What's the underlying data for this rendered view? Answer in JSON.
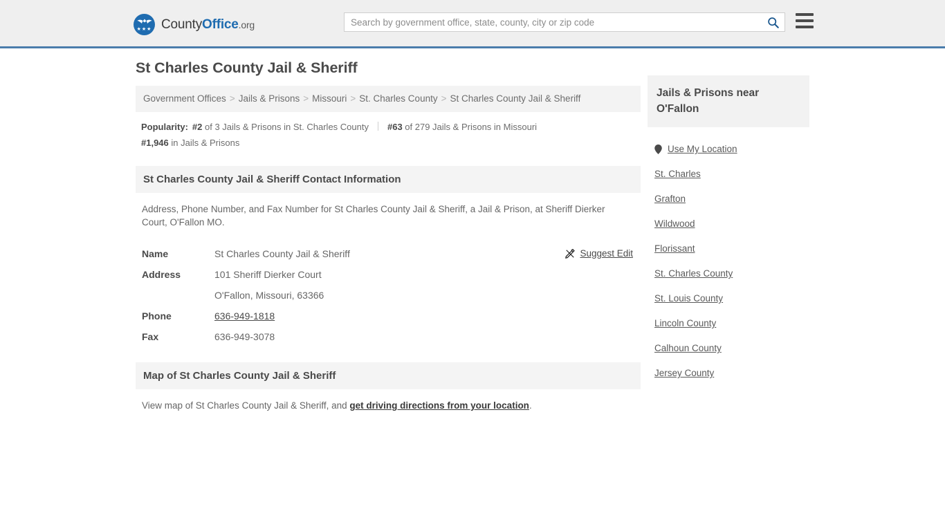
{
  "header": {
    "brand": {
      "name_part1": "County",
      "name_part2": "Office",
      "name_part3": ".org",
      "logo_icon": "eagle-shield-logo",
      "stars": "★★★"
    },
    "search": {
      "placeholder": "Search by government office, state, county, city or zip code",
      "value": "",
      "search_icon": "search-icon"
    },
    "menu_icon": "hamburger-menu-icon",
    "accent_color": "#4a7cab"
  },
  "page": {
    "title": "St Charles County Jail & Sheriff"
  },
  "breadcrumb": {
    "separator": ">",
    "items": [
      {
        "label": "Government Offices"
      },
      {
        "label": "Jails & Prisons"
      },
      {
        "label": "Missouri"
      },
      {
        "label": "St. Charles County"
      },
      {
        "label": "St Charles County Jail & Sheriff"
      }
    ]
  },
  "popularity": {
    "label": "Popularity:",
    "items": [
      {
        "rank": "#2",
        "text": " of 3 Jails & Prisons in St. Charles County"
      },
      {
        "rank": "#63",
        "text": " of 279 Jails & Prisons in Missouri"
      },
      {
        "rank": "#1,946",
        "text": " in Jails & Prisons"
      }
    ]
  },
  "contact_section": {
    "heading": "St Charles County Jail & Sheriff Contact Information",
    "description": "Address, Phone Number, and Fax Number for St Charles County Jail & Sheriff, a Jail & Prison, at Sheriff Dierker Court, O'Fallon MO.",
    "suggest_edit": {
      "label": "Suggest Edit",
      "icon": "edit-pencil-icon"
    },
    "rows": [
      {
        "key": "Name",
        "value": "St Charles County Jail & Sheriff",
        "link": false
      },
      {
        "key": "Address",
        "value": "101 Sheriff Dierker Court",
        "link": false
      },
      {
        "key": "",
        "value": "O'Fallon, Missouri, 63366",
        "link": false
      },
      {
        "key": "Phone",
        "value": "636-949-1818",
        "link": true
      },
      {
        "key": "Fax",
        "value": "636-949-3078",
        "link": false
      }
    ]
  },
  "map_section": {
    "heading": "Map of St Charles County Jail & Sheriff",
    "text_before": "View map of St Charles County Jail & Sheriff, and ",
    "link_label": "get driving directions from your location",
    "text_after": "."
  },
  "sidebar": {
    "heading": "Jails & Prisons near O'Fallon",
    "items": [
      {
        "label": "Use My Location",
        "icon": "map-pin-icon"
      },
      {
        "label": "St. Charles",
        "icon": ""
      },
      {
        "label": "Grafton",
        "icon": ""
      },
      {
        "label": "Wildwood",
        "icon": ""
      },
      {
        "label": "Florissant",
        "icon": ""
      },
      {
        "label": "St. Charles County",
        "icon": ""
      },
      {
        "label": "St. Louis County",
        "icon": ""
      },
      {
        "label": "Lincoln County",
        "icon": ""
      },
      {
        "label": "Calhoun County",
        "icon": ""
      },
      {
        "label": "Jersey County",
        "icon": ""
      }
    ]
  }
}
